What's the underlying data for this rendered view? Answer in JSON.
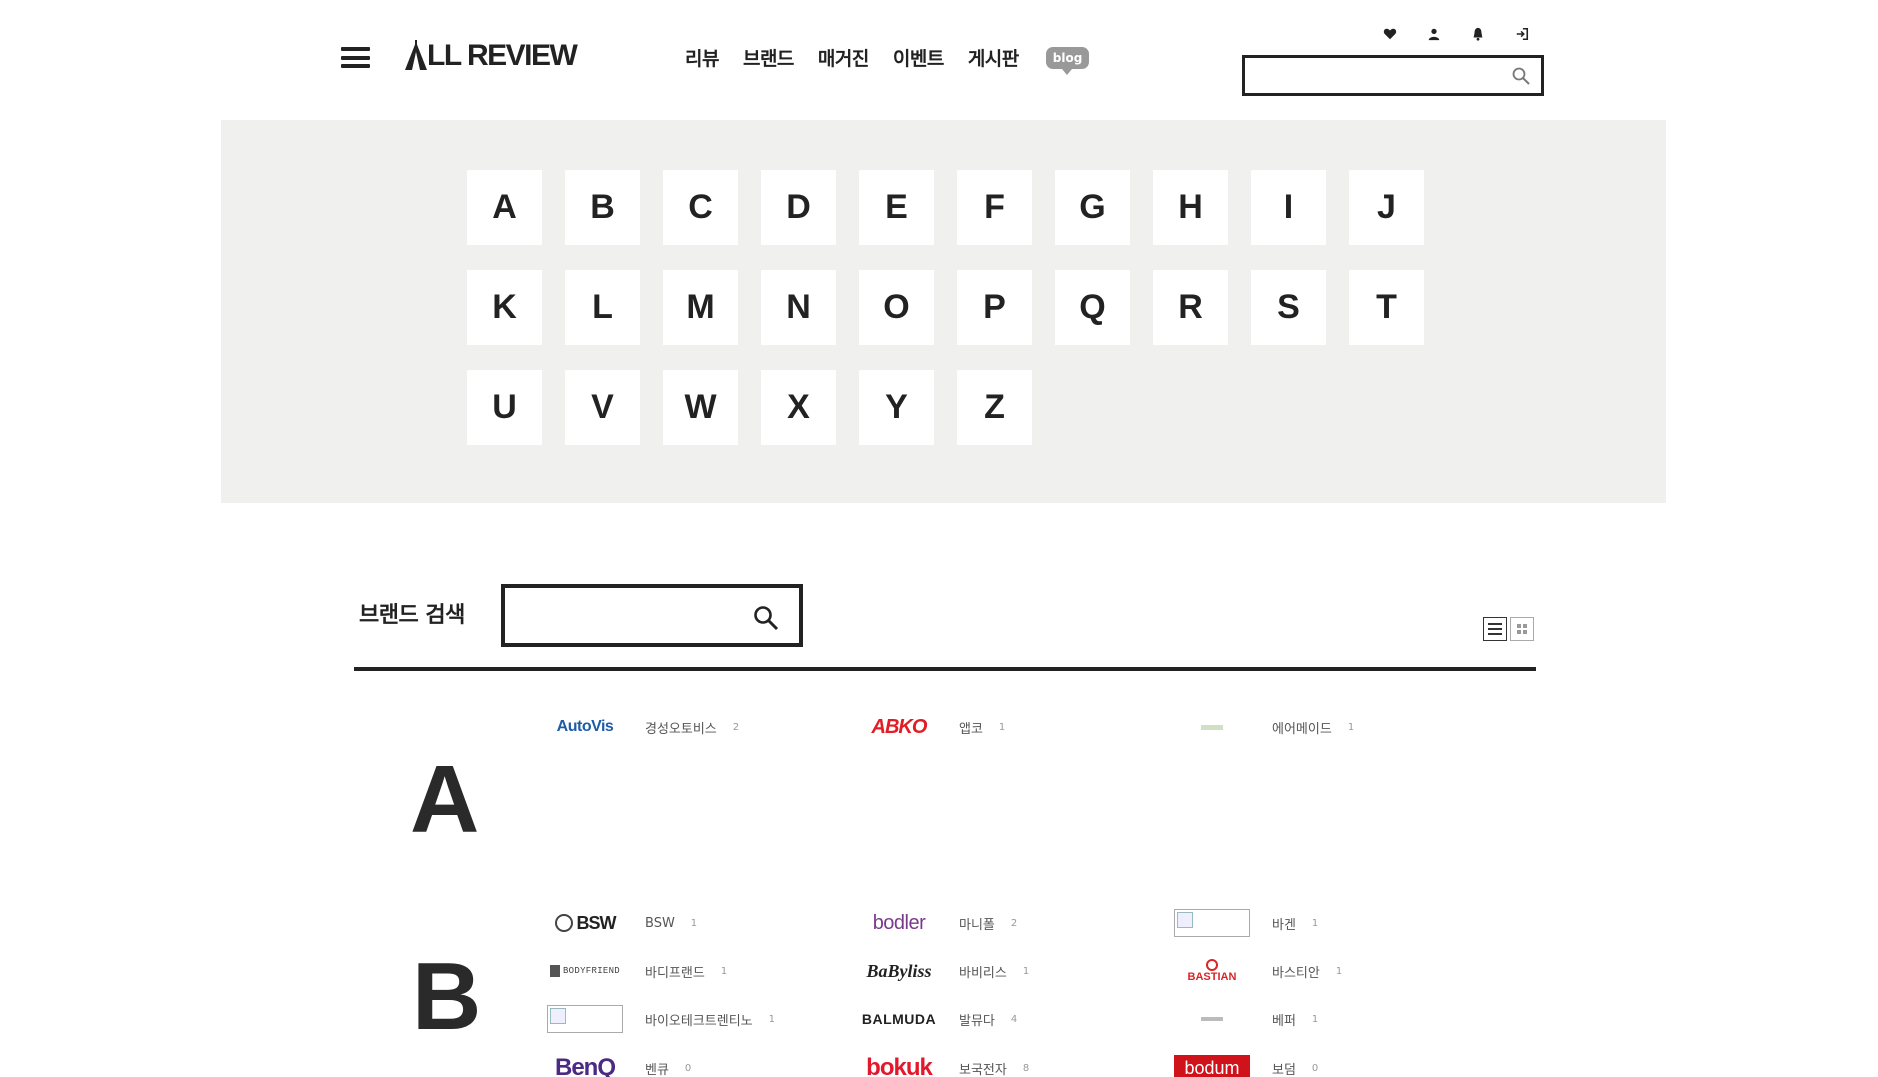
{
  "header": {
    "logo_text": "LL REVIEW",
    "nav": [
      "리뷰",
      "브랜드",
      "매거진",
      "이벤트",
      "게시판"
    ],
    "blog_label": "blog",
    "search_placeholder": ""
  },
  "alphabet": [
    "A",
    "B",
    "C",
    "D",
    "E",
    "F",
    "G",
    "H",
    "I",
    "J",
    "K",
    "L",
    "M",
    "N",
    "O",
    "P",
    "Q",
    "R",
    "S",
    "T",
    "U",
    "V",
    "W",
    "X",
    "Y",
    "Z"
  ],
  "brand_search": {
    "label": "브랜드 검색",
    "placeholder": ""
  },
  "sections": [
    {
      "letter": "A",
      "brands": [
        {
          "logo_text": "AutoVis",
          "name": "경성오토비스",
          "count": "2"
        },
        {
          "logo_text": "ABKO",
          "name": "앱코",
          "count": "1"
        },
        {
          "logo_text": "",
          "name": "에어메이드",
          "count": "1"
        }
      ]
    },
    {
      "letter": "B",
      "brands": [
        {
          "logo_text": "BSW",
          "name": "BSW",
          "count": "1"
        },
        {
          "logo_text": "bodler",
          "name": "마니폴",
          "count": "2"
        },
        {
          "logo_text": "",
          "name": "바겐",
          "count": "1"
        },
        {
          "logo_text": "BODYFRIEND",
          "name": "바디프랜드",
          "count": "1"
        },
        {
          "logo_text": "BaByliss",
          "name": "바비리스",
          "count": "1"
        },
        {
          "logo_text": "BASTIAN",
          "name": "바스티안",
          "count": "1"
        },
        {
          "logo_text": "",
          "name": "바이오테크트렌티노",
          "count": "1"
        },
        {
          "logo_text": "BALMUDA",
          "name": "발뮤다",
          "count": "4"
        },
        {
          "logo_text": "",
          "name": "베퍼",
          "count": "1"
        },
        {
          "logo_text": "BenQ",
          "name": "벤큐",
          "count": "0"
        },
        {
          "logo_text": "bokuk",
          "name": "보국전자",
          "count": "8"
        },
        {
          "logo_text": "bodum",
          "name": "보덤",
          "count": "0"
        }
      ]
    }
  ],
  "icons": [
    "menu-icon",
    "heart-icon",
    "user-icon",
    "bell-icon",
    "logout-icon",
    "search-icon",
    "list-view-icon",
    "grid-view-icon"
  ]
}
